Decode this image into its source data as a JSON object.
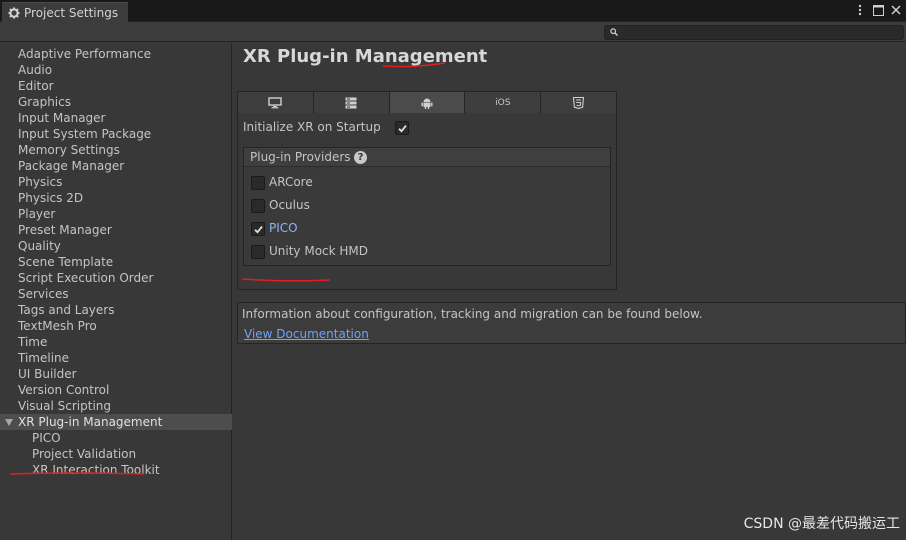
{
  "window": {
    "tab_title": "Project Settings",
    "menu_icon": "more-vert-icon",
    "maximize_icon": "maximize-icon",
    "close_icon": "close-icon",
    "accent_underline_color": "#e02020"
  },
  "search": {
    "placeholder": ""
  },
  "sidebar": {
    "items": [
      {
        "label": "Adaptive Performance"
      },
      {
        "label": "Audio"
      },
      {
        "label": "Editor"
      },
      {
        "label": "Graphics"
      },
      {
        "label": "Input Manager"
      },
      {
        "label": "Input System Package"
      },
      {
        "label": "Memory Settings"
      },
      {
        "label": "Package Manager"
      },
      {
        "label": "Physics"
      },
      {
        "label": "Physics 2D"
      },
      {
        "label": "Player"
      },
      {
        "label": "Preset Manager"
      },
      {
        "label": "Quality"
      },
      {
        "label": "Scene Template"
      },
      {
        "label": "Script Execution Order"
      },
      {
        "label": "Services"
      },
      {
        "label": "Tags and Layers"
      },
      {
        "label": "TextMesh Pro"
      },
      {
        "label": "Time"
      },
      {
        "label": "Timeline"
      },
      {
        "label": "UI Builder"
      },
      {
        "label": "Version Control"
      },
      {
        "label": "Visual Scripting"
      },
      {
        "label": "XR Plug-in Management",
        "selected": true,
        "expanded": true
      },
      {
        "label": "PICO",
        "sub": true
      },
      {
        "label": "Project Validation",
        "sub": true
      },
      {
        "label": "XR Interaction Toolkit",
        "sub": true
      }
    ]
  },
  "main": {
    "title": "XR Plug-in Management",
    "platform_tabs": [
      {
        "icon": "desktop-icon",
        "active": false
      },
      {
        "icon": "server-icon",
        "active": false
      },
      {
        "icon": "android-icon",
        "active": true
      },
      {
        "label": "iOS",
        "active": false
      },
      {
        "icon": "html5-icon",
        "active": false
      }
    ],
    "init_label": "Initialize XR on Startup",
    "init_checked": true,
    "providers_header": "Plug-in Providers",
    "providers": [
      {
        "label": "ARCore",
        "checked": false
      },
      {
        "label": "Oculus",
        "checked": false
      },
      {
        "label": "PICO",
        "checked": true
      },
      {
        "label": "Unity Mock HMD",
        "checked": false
      }
    ],
    "info_text": "Information about configuration, tracking and migration can be found below.",
    "info_link": "View Documentation"
  },
  "watermark": "CSDN @最差代码搬运工"
}
